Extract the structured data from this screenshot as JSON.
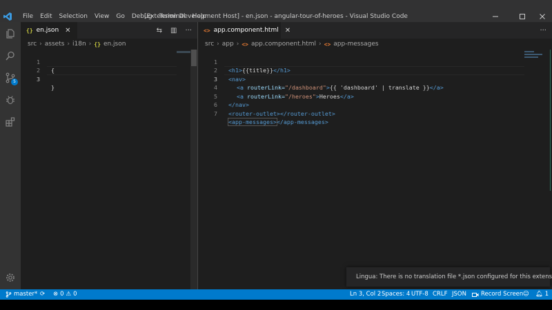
{
  "menu": [
    "File",
    "Edit",
    "Selection",
    "View",
    "Go",
    "Debug",
    "Terminal",
    "Help"
  ],
  "window_title": "[Extension Development Host] - en.json - angular-tour-of-heroes - Visual Studio Code",
  "activity": {
    "scm_badge": "5"
  },
  "left_editor": {
    "tab_icon": "{}",
    "tab_label": "en.json",
    "breadcrumb": [
      "src",
      "assets",
      "i18n",
      "en.json"
    ],
    "breadcrumb_icon": "{}",
    "line_numbers": [
      "1",
      "2",
      "3"
    ],
    "lines": [
      "{",
      "",
      "}"
    ]
  },
  "right_editor": {
    "tab_icon": "<>",
    "tab_label": "app.component.html",
    "breadcrumb": [
      "src",
      "app",
      "app.component.html",
      "app-messages"
    ],
    "line_numbers": [
      "1",
      "2",
      "3",
      "4",
      "5",
      "6",
      "7"
    ],
    "code": {
      "l1": [
        "<h1>",
        "{{title}}",
        "</h1>"
      ],
      "l2": [
        "<nav>"
      ],
      "l3": [
        "<a ",
        "routerLink=",
        "\"/dashboard\"",
        ">",
        "{{ 'dashboard' | translate }}",
        "</a>"
      ],
      "l4": [
        "<a ",
        "routerLink=",
        "\"/heroes\"",
        ">",
        "Heroes",
        "</a>"
      ],
      "l5": [
        "</nav>"
      ],
      "l6": [
        "<router-outlet>",
        "</router-outlet>"
      ],
      "l7": [
        "<app-messages>",
        "</app-messages>"
      ]
    }
  },
  "notification": {
    "message": "Lingua: There is no translation file *.json configured for this extension. ..."
  },
  "status": {
    "branch": "master*",
    "errors": "0",
    "warnings": "0",
    "position": "Ln 3, Col 2",
    "spaces": "Spaces: 4",
    "encoding": "UTF-8",
    "eol": "CRLF",
    "language": "JSON",
    "record": "Record Screen",
    "bell": "1"
  },
  "colors": {
    "titlebar": "#323233",
    "activitybar": "#333333",
    "editor": "#1e1e1e",
    "statusbar": "#007acc",
    "warning": "#cca700"
  }
}
